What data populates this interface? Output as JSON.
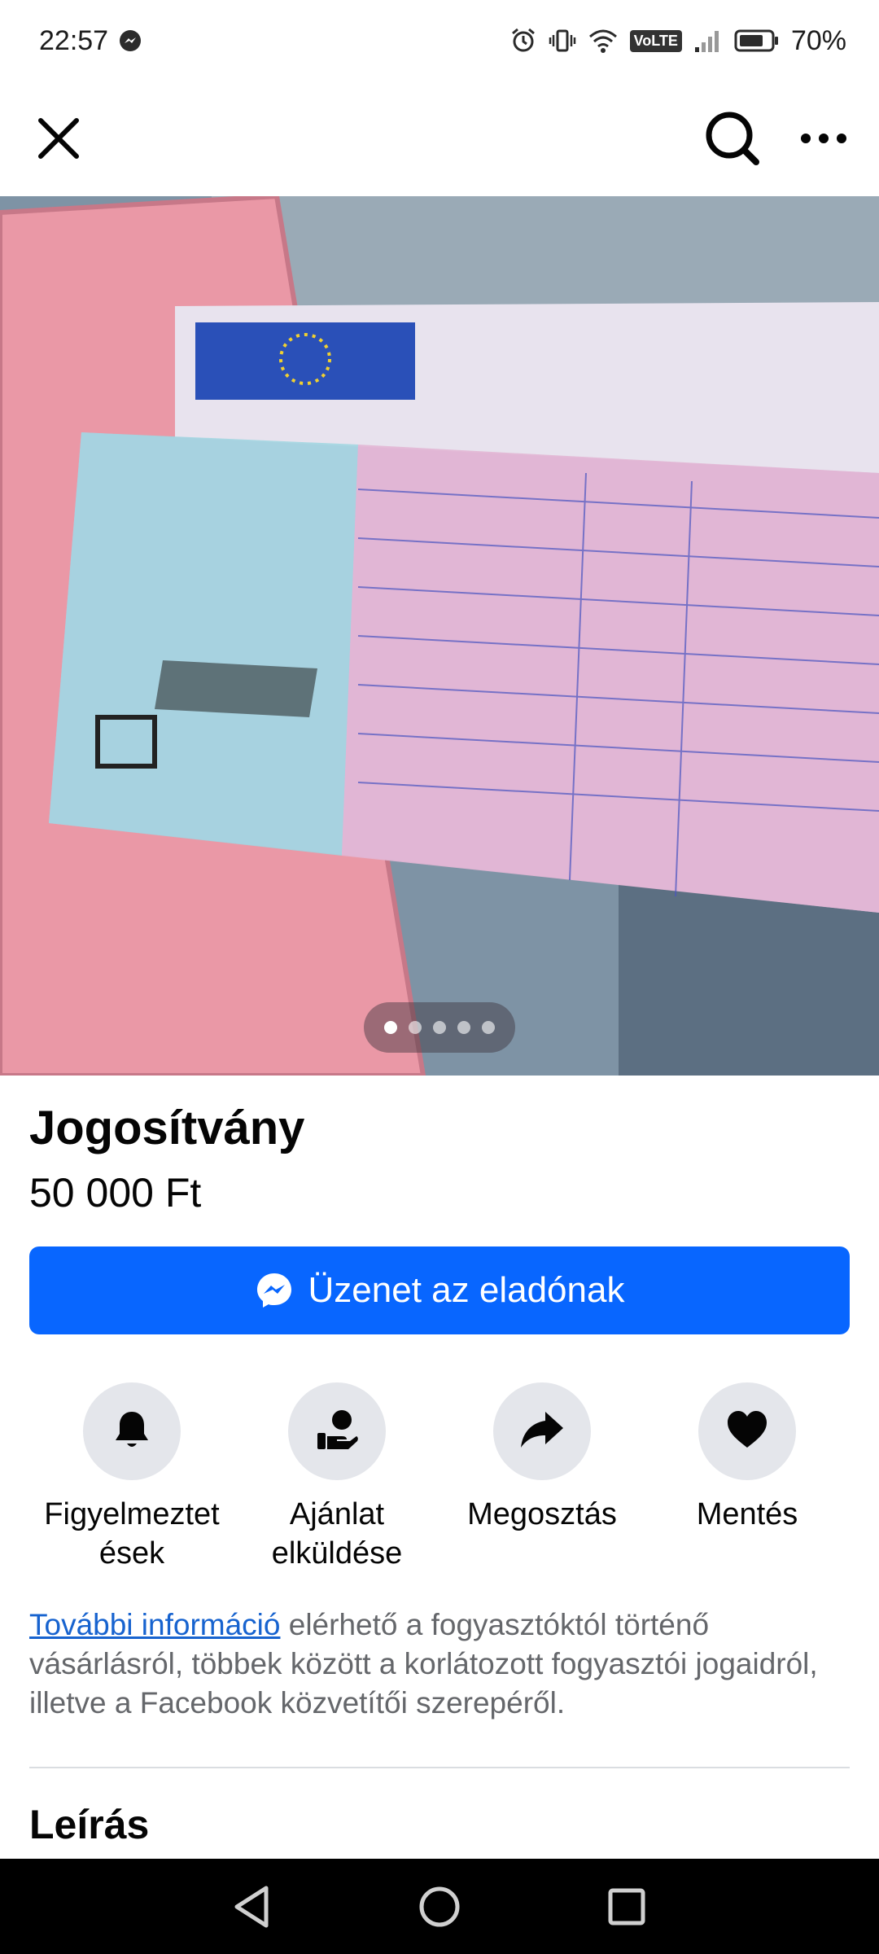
{
  "status_bar": {
    "time": "22:57",
    "battery": "70%",
    "network_badge": "VoLTE",
    "icons": [
      "messenger-icon",
      "alarm-icon",
      "vibrate-icon",
      "wifi-icon",
      "signal-icon",
      "battery-icon"
    ]
  },
  "nav": {
    "icons": [
      "close-icon",
      "search-icon",
      "more-icon"
    ]
  },
  "gallery": {
    "image_count": 5,
    "current_index": 1
  },
  "listing": {
    "title": "Jogosítvány",
    "price": "50 000 Ft"
  },
  "message_button": {
    "label": "Üzenet az eladónak",
    "icon": "messenger-icon",
    "color": "#0866ff"
  },
  "actions": [
    {
      "label": "Figyelmeztet\nések",
      "icon": "bell-icon"
    },
    {
      "label": "Ajánlat elküldése",
      "icon": "offer-hand-icon"
    },
    {
      "label": "Megosztás",
      "icon": "share-icon"
    },
    {
      "label": "Mentés",
      "icon": "heart-icon"
    }
  ],
  "info": {
    "link_text": "További információ",
    "text": " elérhető a fogyasztóktól történő vásárlásról, többek között a korlátozott fogyasztói jogaidról, illetve a Facebook közvetítői szerepéről."
  },
  "description": {
    "heading": "Leírás"
  },
  "android_nav": {
    "icons": [
      "back-icon",
      "home-icon",
      "recents-icon"
    ]
  }
}
